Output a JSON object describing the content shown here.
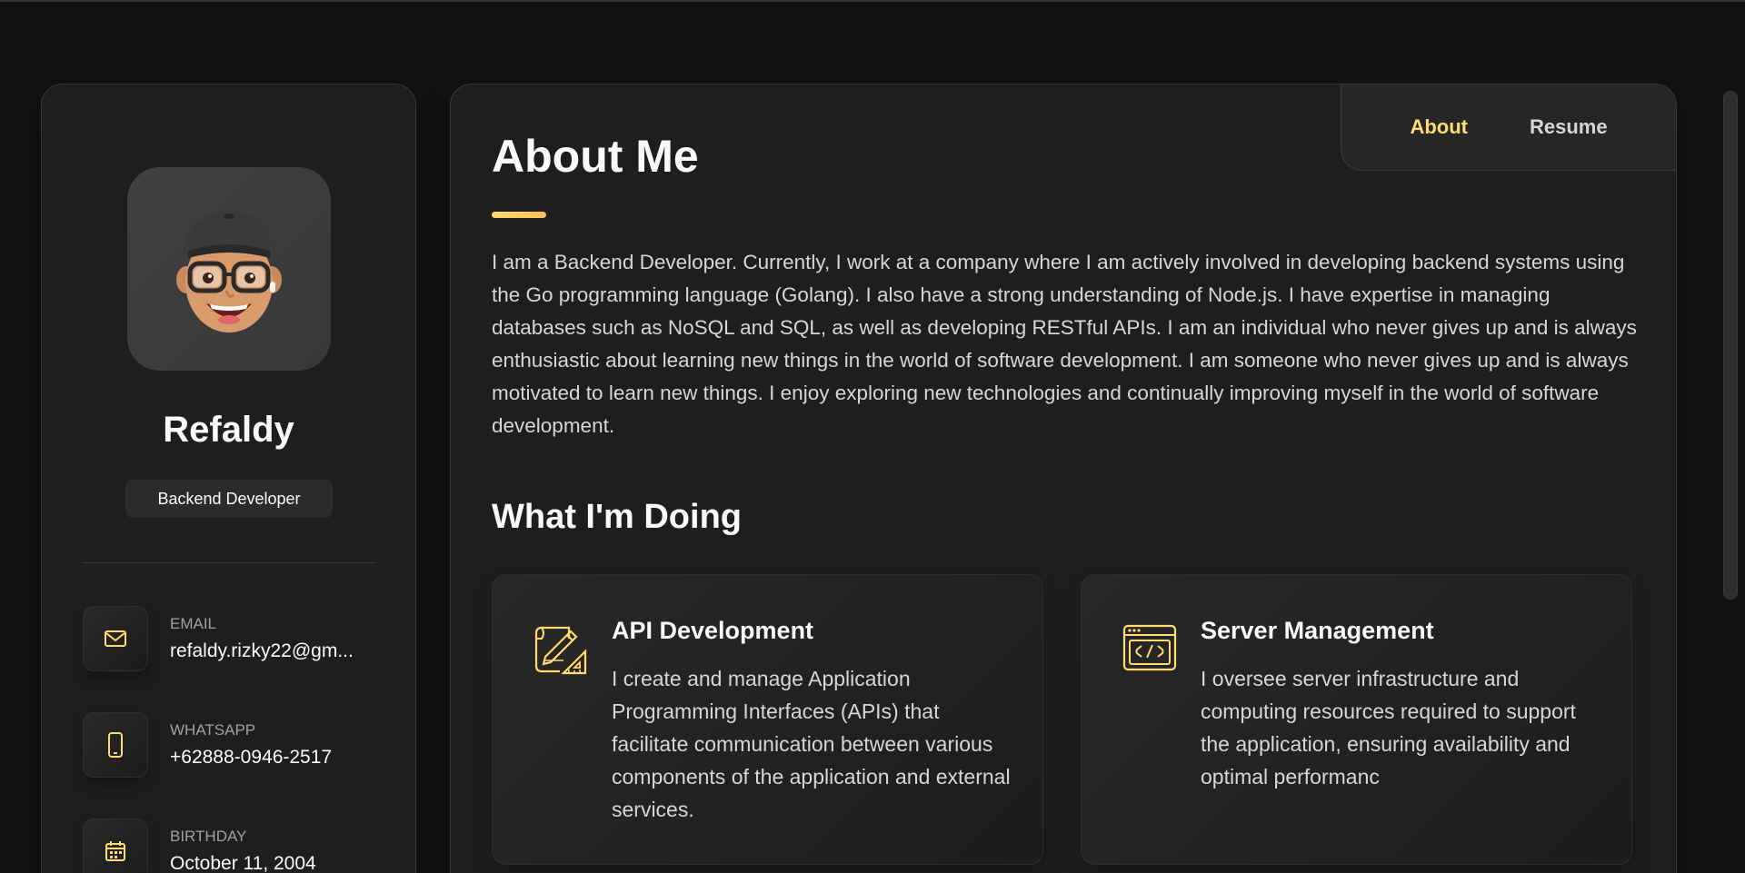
{
  "profile": {
    "name": "Refaldy",
    "title": "Backend Developer"
  },
  "contacts": [
    {
      "label": "Email",
      "value": "refaldy.rizky22@gm...",
      "icon": "mail-icon"
    },
    {
      "label": "Whatsapp",
      "value": "+62888-0946-2517",
      "icon": "phone-icon"
    },
    {
      "label": "Birthday",
      "value": "October 11, 2004",
      "icon": "calendar-icon"
    }
  ],
  "navbar": {
    "items": [
      {
        "label": "About",
        "active": true
      },
      {
        "label": "Resume",
        "active": false
      }
    ]
  },
  "about": {
    "title": "About Me",
    "text": "I am a Backend Developer. Currently, I work at a company where I am actively involved in developing backend systems using the Go programming language (Golang). I also have a strong understanding of Node.js. I have expertise in managing databases such as NoSQL and SQL, as well as developing RESTful APIs. I am an individual who never gives up and is always enthusiastic about learning new things in the world of software development. I am someone who never gives up and is always motivated to learn new things. I enjoy exploring new technologies and continually improving myself in the world of software development."
  },
  "services": {
    "title": "What I'm Doing",
    "items": [
      {
        "title": "API Development",
        "text": "I create and manage Application Programming Interfaces (APIs) that facilitate communication between various components of the application and external services.",
        "icon": "design-tools-icon"
      },
      {
        "title": "Server Management",
        "text": "I oversee server infrastructure and computing resources required to support the application, ensuring availability and optimal performanc",
        "icon": "code-window-icon"
      }
    ]
  },
  "colors": {
    "accent": "#ffdb70",
    "background": "#121212",
    "card": "#1e1e1f"
  }
}
